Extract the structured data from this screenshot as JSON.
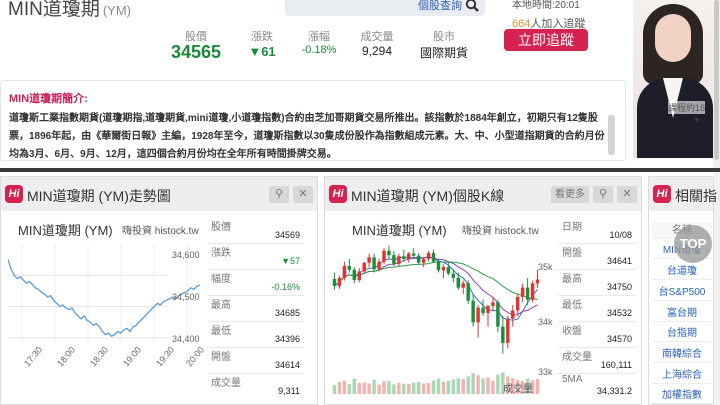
{
  "header": {
    "title": "MIN道瓊期",
    "symbol": "(YM)",
    "search_button": "個股查詢",
    "search_placeholder": "",
    "local_time": "本地時間:20:01",
    "followers_count": "664",
    "followers_suffix": "人加入追蹤",
    "track_button": "立即追蹤"
  },
  "quote": {
    "price_label": "股價",
    "price": "34565",
    "change_label": "漲跌",
    "change": "▼61",
    "pct_label": "漲幅",
    "pct": "-0.18%",
    "volume_label": "成交量",
    "volume": "9,294",
    "market_label": "股市",
    "market": "國際期貨"
  },
  "ad": {
    "text1": "課程約16",
    "text2": "+"
  },
  "intro": {
    "title": "MIN道瓊期簡介:",
    "text": "道瓊斯工業指數期貨(道瓊期指,道瓊期貨,mini道瓊,小道瓊指數)合約由芝加哥期貨交易所推出。該指數於1884年創立，初期只有12隻股票，1896年起，由《華爾街日報》主編，1928年至今，道瓊斯指數以30隻成份股作為指數組成元素。大、中、小型道指期貨的合約月份均為3月、6月、9月、12月，這四個合約月份均在全年所有時間掛牌交易。"
  },
  "trend_panel": {
    "title": "MIN道瓊期 (YM)走勢圖",
    "chart_label": "MIN道瓊期 (YM)",
    "brand": "嗨投資 histock.tw",
    "y_ticks": [
      "34,600",
      "34,500",
      "34,400"
    ],
    "x_ticks": [
      "17:30",
      "18:00",
      "18:30",
      "19:00",
      "19:30",
      "20:00"
    ],
    "stats": [
      {
        "label": "股價",
        "value": "34569"
      },
      {
        "label": "漲跌",
        "value": "▼57"
      },
      {
        "label": "幅度",
        "value": "-0.16%"
      },
      {
        "label": "最高",
        "value": "34685"
      },
      {
        "label": "最低",
        "value": "34396"
      },
      {
        "label": "開盤",
        "value": "34614"
      },
      {
        "label": "成交量",
        "value": "9,311"
      }
    ]
  },
  "kline_panel": {
    "title": "MIN道瓊期 (YM)個股K線",
    "more_button": "看更多",
    "chart_label": "MIN道瓊期 (YM)",
    "brand": "嗨投資 histock.tw",
    "y_ticks": [
      "35k",
      "34k",
      "33k"
    ],
    "volume_label": "成交量",
    "stats": [
      {
        "label": "日期",
        "value": "10/08"
      },
      {
        "label": "開盤",
        "value": "34641"
      },
      {
        "label": "最高",
        "value": "34750"
      },
      {
        "label": "最低",
        "value": "34532"
      },
      {
        "label": "收盤",
        "value": "34570"
      },
      {
        "label": "成交量",
        "value": "160,111"
      },
      {
        "label": "5MA",
        "value": "34,331.2"
      }
    ]
  },
  "related_panel": {
    "title": "相關指",
    "header": "名稱",
    "items": [
      "MIN道瓊",
      "台道瓊",
      "台S&P500",
      "富台期",
      "台指期",
      "南韓綜合",
      "上海綜合",
      "加權指數"
    ]
  },
  "top_button": "TOP",
  "chart_data": [
    {
      "type": "line",
      "title": "MIN道瓊期 (YM)",
      "x": [
        "17:30",
        "18:00",
        "18:30",
        "19:00",
        "19:30",
        "20:00"
      ],
      "ylim": [
        34380,
        34700
      ],
      "series": [
        {
          "values": [
            34650,
            34620,
            34600,
            34590,
            34595,
            34585,
            34575,
            34580,
            34570,
            34560,
            34555,
            34545,
            34540,
            34530,
            34535,
            34520,
            34510,
            34500,
            34505,
            34495,
            34490,
            34495,
            34480,
            34470,
            34460,
            34470,
            34455,
            34450,
            34440,
            34445,
            34435,
            34420,
            34410,
            34415,
            34405,
            34410,
            34420,
            34415,
            34425,
            34430,
            34420,
            34435,
            34440,
            34450,
            34460,
            34470,
            34480,
            34490,
            34500,
            34510,
            34505,
            34515,
            34520,
            34525,
            34530,
            34525,
            34535,
            34540,
            34545,
            34550,
            34560,
            34555,
            34565,
            34569
          ]
        }
      ]
    },
    {
      "type": "candlestick",
      "title": "MIN道瓊期 (YM)",
      "ylim": [
        32900,
        35300
      ],
      "candles": [
        [
          34580,
          34700,
          34380,
          34450
        ],
        [
          34450,
          34640,
          34400,
          34600
        ],
        [
          34600,
          34900,
          34550,
          34820
        ],
        [
          34820,
          34950,
          34700,
          34750
        ],
        [
          34750,
          34800,
          34500,
          34560
        ],
        [
          34560,
          34780,
          34520,
          34720
        ],
        [
          34720,
          34900,
          34680,
          34880
        ],
        [
          34880,
          35050,
          34800,
          34980
        ],
        [
          34980,
          35050,
          34700,
          34760
        ],
        [
          34760,
          34950,
          34720,
          34900
        ],
        [
          34900,
          35150,
          34850,
          35100
        ],
        [
          35100,
          35200,
          34950,
          35020
        ],
        [
          35020,
          35100,
          34820,
          34860
        ],
        [
          34860,
          35050,
          34820,
          35000
        ],
        [
          35000,
          35120,
          34900,
          34950
        ],
        [
          34950,
          35080,
          34880,
          35050
        ],
        [
          35050,
          35150,
          34960,
          35010
        ],
        [
          35010,
          35060,
          34850,
          34880
        ],
        [
          34880,
          34990,
          34800,
          34950
        ],
        [
          34950,
          35100,
          34900,
          35060
        ],
        [
          35060,
          35120,
          34880,
          34900
        ],
        [
          34900,
          34960,
          34700,
          34740
        ],
        [
          34740,
          34850,
          34600,
          34800
        ],
        [
          34800,
          34900,
          34650,
          34680
        ],
        [
          34680,
          34760,
          34520,
          34600
        ],
        [
          34600,
          34700,
          34380,
          34420
        ],
        [
          34420,
          34550,
          34300,
          34500
        ],
        [
          34500,
          34560,
          34120,
          34180
        ],
        [
          34180,
          34300,
          33700,
          33780
        ],
        [
          33780,
          34100,
          33500,
          34050
        ],
        [
          34050,
          34200,
          33900,
          33950
        ],
        [
          33950,
          34100,
          33700,
          34080
        ],
        [
          34080,
          34250,
          33980,
          34150
        ],
        [
          34150,
          34200,
          33600,
          33700
        ],
        [
          33700,
          33900,
          33200,
          33400
        ],
        [
          33400,
          33900,
          33300,
          33850
        ],
        [
          33850,
          34100,
          33700,
          34000
        ],
        [
          34000,
          34300,
          33900,
          34250
        ],
        [
          34250,
          34500,
          34150,
          34420
        ],
        [
          34420,
          34600,
          34100,
          34200
        ],
        [
          34200,
          34550,
          34150,
          34500
        ],
        [
          34500,
          34750,
          34420,
          34570
        ]
      ],
      "volume": [
        40,
        55,
        60,
        45,
        70,
        50,
        52,
        48,
        65,
        42,
        58,
        60,
        44,
        50,
        47,
        46,
        52,
        55,
        48,
        50,
        62,
        70,
        55,
        60,
        66,
        72,
        68,
        80,
        95,
        85,
        70,
        75,
        60,
        88,
        98,
        80,
        72,
        65,
        60,
        70,
        62,
        68
      ]
    }
  ]
}
